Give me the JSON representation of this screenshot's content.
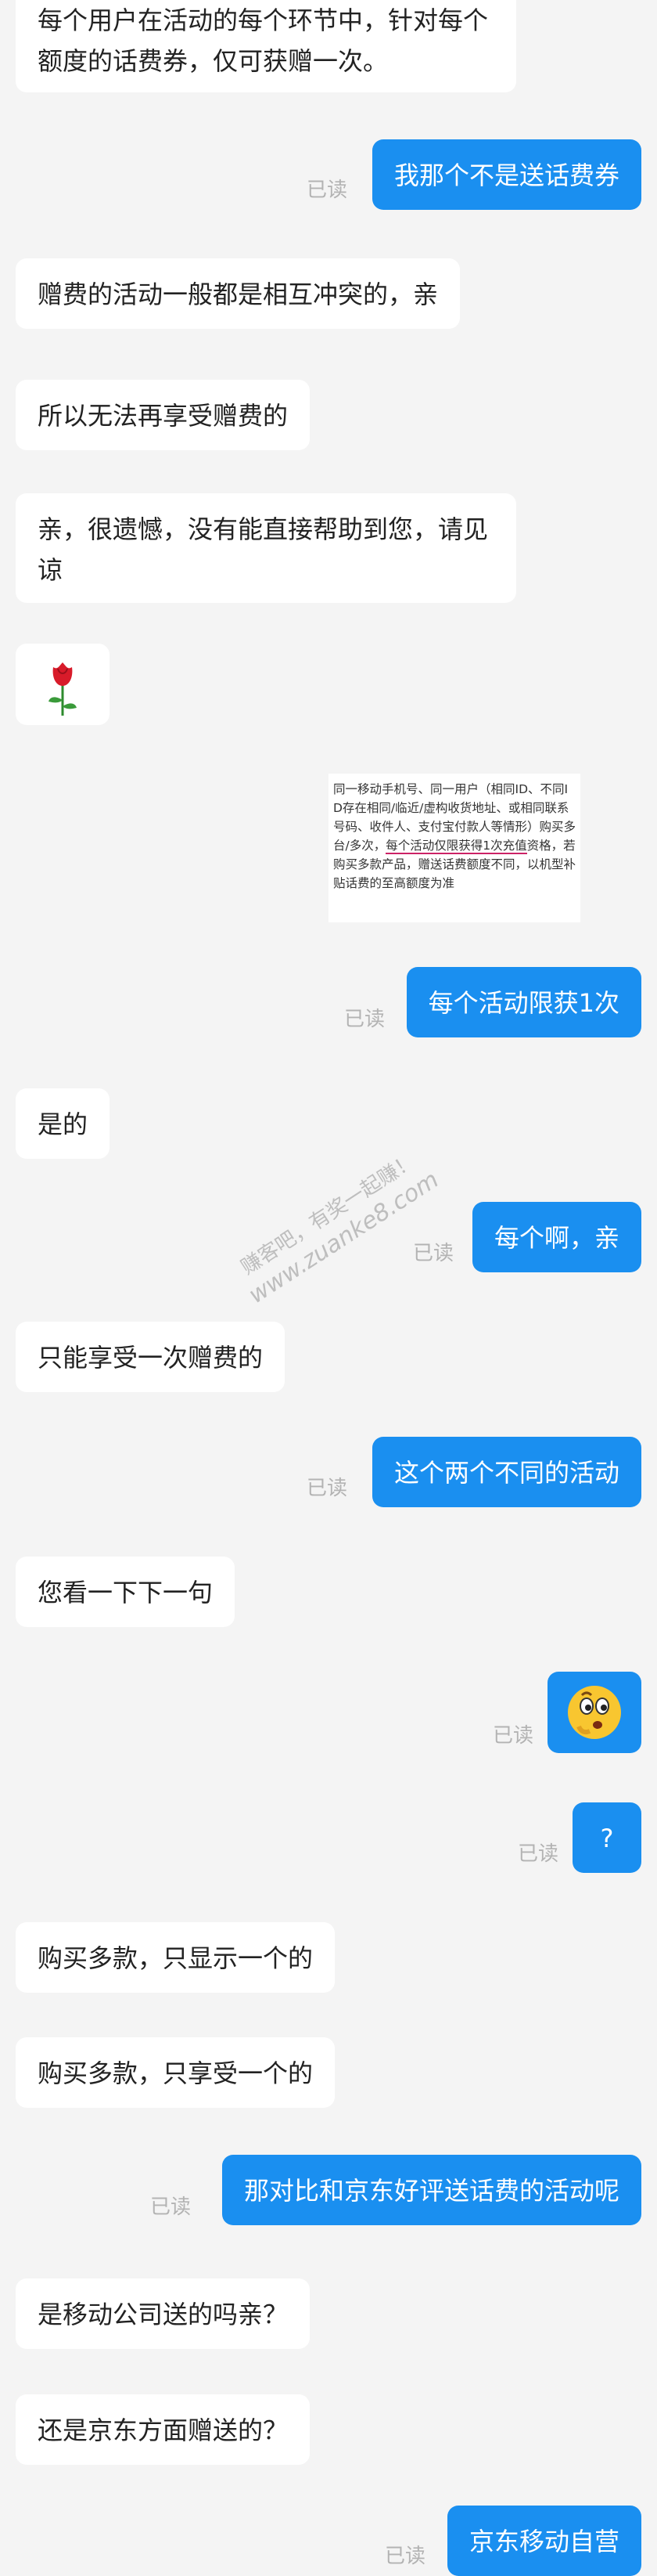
{
  "read_label": "已读",
  "messages": {
    "m1": "每个用户在活动的每个环节中，针对每个额度的话费券，仅可获赠一次。",
    "m2": "我那个不是送话费券",
    "m3": "赠费的活动一般都是相互冲突的，亲",
    "m4": "所以无法再享受赠费的",
    "m5": "亲，很遗憾，没有能直接帮助到您，请见谅",
    "m7": "每个活动限获1次",
    "m8": "是的",
    "m9": "每个啊，亲",
    "m10": "只能享受一次赠费的",
    "m11": "这个两个不同的活动",
    "m12": "您看一下下一句",
    "m14": "?",
    "m15": "购买多款，只显示一个的",
    "m16": "购买多款，只享受一个的",
    "m17": "那对比和京东好评送话费的活动呢",
    "m18": "是移动公司送的吗亲？",
    "m19": "还是京东方面赠送的？",
    "m20": "京东移动自营"
  },
  "image_message": {
    "text_before": "同一移动手机号、同一用户（相同ID、不同ID存在相同/临近/虚构收货地址、或相同联系号码、收件人、支付宝付款人等情形）购买多台/多次，",
    "text_highlight": "每个活动仅限获得1次充值",
    "text_after": "资格，若购买多款产品，赠送话费额度不同，以机型补贴话费的至高额度为准"
  },
  "watermark": {
    "line1": "赚客吧，有奖一起赚！",
    "line2": "www.zuanke8.com"
  },
  "colors": {
    "user_bubble": "#1a8ff0",
    "agent_bubble": "#ffffff",
    "background": "#f4f4f4",
    "read_text": "#b3b3b3",
    "highlight_underline": "#cc2266"
  },
  "icons": {
    "rose": "rose-emoji-icon",
    "thinking_face": "thinking-face-emoji-icon"
  }
}
